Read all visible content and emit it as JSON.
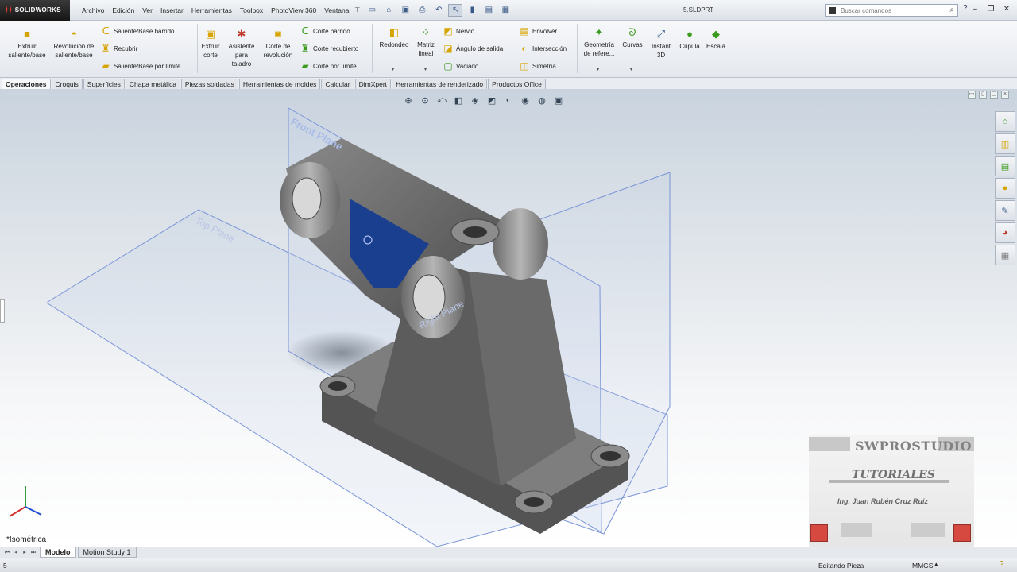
{
  "app": {
    "logo_text": "SOLIDWORKS",
    "doc_title": "5.SLDPRT"
  },
  "menu": [
    "Archivo",
    "Edición",
    "Ver",
    "Insertar",
    "Herramientas",
    "Toolbox",
    "PhotoView 360",
    "Ventana"
  ],
  "search": {
    "placeholder": "Buscar comandos"
  },
  "ribbon": {
    "extrude_boss": "Extruir saliente/base",
    "revolve_boss": "Revolución de saliente/base",
    "swept_boss": "Saliente/Base barrido",
    "loft": "Recubrir",
    "boundary_boss": "Saliente/Base por límite",
    "extrude_cut": "Extruir corte",
    "hole_wizard": "Asistente para taladro",
    "revolve_cut": "Corte de revolución",
    "swept_cut": "Corte barrido",
    "lofted_cut": "Corte recubierto",
    "boundary_cut": "Corte por límite",
    "fillet": "Redondeo",
    "linear_pattern": "Matriz lineal",
    "rib": "Nervio",
    "draft": "Ángulo de salida",
    "shell": "Vaciado",
    "wrap": "Envolver",
    "intersect": "Intersección",
    "mirror": "Simetría",
    "ref_geometry": "Geometría de refere...",
    "curves": "Curvas",
    "instant3d": "Instant 3D",
    "dome": "Cúpula",
    "scale": "Escala"
  },
  "tabs": [
    "Operaciones",
    "Croquis",
    "Superficies",
    "Chapa metálica",
    "Piezas soldadas",
    "Herramientas de moldes",
    "Calcular",
    "DimXpert",
    "Herramientas de renderizado",
    "Productos Office"
  ],
  "viewport": {
    "plane_front": "Front Plane",
    "plane_top": "Top Plane",
    "plane_right": "Right Plane",
    "view_name": "*Isométrica"
  },
  "watermark": {
    "brand": "SWPROSTUDIO",
    "subtitle": "TUTORIALES",
    "author": "Ing. Juan Rubén Cruz Ruiz"
  },
  "bottom_tabs": [
    "Modelo",
    "Motion Study 1"
  ],
  "status": {
    "left": "5",
    "mode": "Editando Pieza",
    "units": "MMGS"
  },
  "colors": {
    "part": "#5f5f5f",
    "selected_face": "#1a3f8f",
    "plane": "#6f8fd8",
    "accent": "#e23b2e"
  }
}
